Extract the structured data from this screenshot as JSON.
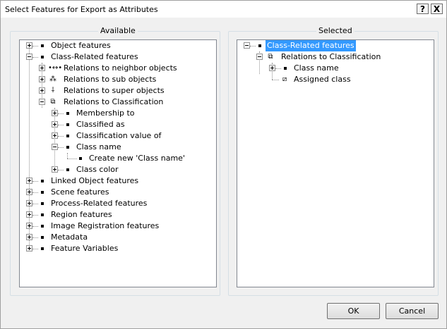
{
  "window": {
    "title": "Select Features for Export as Attributes",
    "help_glyph": "?",
    "close_glyph": "X"
  },
  "available": {
    "legend": "Available",
    "items": [
      {
        "label": "Object features",
        "icon": "bullet"
      },
      {
        "label": "Class-Related features",
        "icon": "bullet"
      },
      {
        "label": "Relations to neighbor objects",
        "icon": "neighbor-relations-icon"
      },
      {
        "label": "Relations to sub objects",
        "icon": "sub-objects-icon"
      },
      {
        "label": "Relations to super objects",
        "icon": "super-objects-icon"
      },
      {
        "label": "Relations to Classification",
        "icon": "classification-icon"
      },
      {
        "label": "Membership to",
        "icon": "bullet"
      },
      {
        "label": "Classified as",
        "icon": "bullet"
      },
      {
        "label": "Classification value of",
        "icon": "bullet"
      },
      {
        "label": "Class name",
        "icon": "bullet"
      },
      {
        "label": "Create new 'Class name'",
        "icon": "bullet"
      },
      {
        "label": "Class color",
        "icon": "bullet"
      },
      {
        "label": "Linked Object features",
        "icon": "bullet"
      },
      {
        "label": "Scene features",
        "icon": "bullet"
      },
      {
        "label": "Process-Related features",
        "icon": "bullet"
      },
      {
        "label": "Region features",
        "icon": "bullet"
      },
      {
        "label": "Image Registration features",
        "icon": "bullet"
      },
      {
        "label": "Metadata",
        "icon": "bullet"
      },
      {
        "label": "Feature Variables",
        "icon": "bullet"
      }
    ]
  },
  "selected": {
    "legend": "Selected",
    "items": [
      {
        "label": "Class-Related features",
        "icon": "bullet",
        "selected": true
      },
      {
        "label": "Relations to Classification",
        "icon": "classification-icon"
      },
      {
        "label": "Class name",
        "icon": "bullet"
      },
      {
        "label": "Assigned class",
        "icon": "assigned-class-icon"
      }
    ]
  },
  "buttons": {
    "ok": "OK",
    "cancel": "Cancel"
  },
  "colors": {
    "selection": "#3399ff",
    "window_bg": "#f0f0f0"
  }
}
